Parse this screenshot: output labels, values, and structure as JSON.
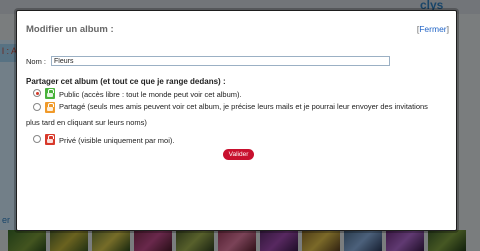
{
  "background": {
    "logo_text": "clys",
    "left_text_1": "l : Ac",
    "left_text_2": "er"
  },
  "dialog": {
    "title": "Modifier un album :",
    "close_open_bracket": "[",
    "close_label": "Fermer",
    "close_close_bracket": "]",
    "name_label": "Nom :",
    "name_value": "Fleurs",
    "share_title": "Partager cet album (et tout ce que je range dedans) :",
    "options": [
      {
        "label": "Public (accès libre : tout le monde peut voir cet album).",
        "checked": true,
        "lock_color": "#49b33b"
      },
      {
        "label": "Partagé (seuls mes amis peuvent voir cet album, je précise leurs mails et je pourrai leur envoyer des invitations",
        "label_continued": "plus tard en cliquant sur leurs noms)",
        "checked": false,
        "lock_color": "#f09a2a"
      },
      {
        "label": "Privé (visible uniquement par moi).",
        "checked": false,
        "lock_color": "#d8392b"
      }
    ],
    "validate_label": "Valider",
    "accent_color": "#c8102e"
  }
}
